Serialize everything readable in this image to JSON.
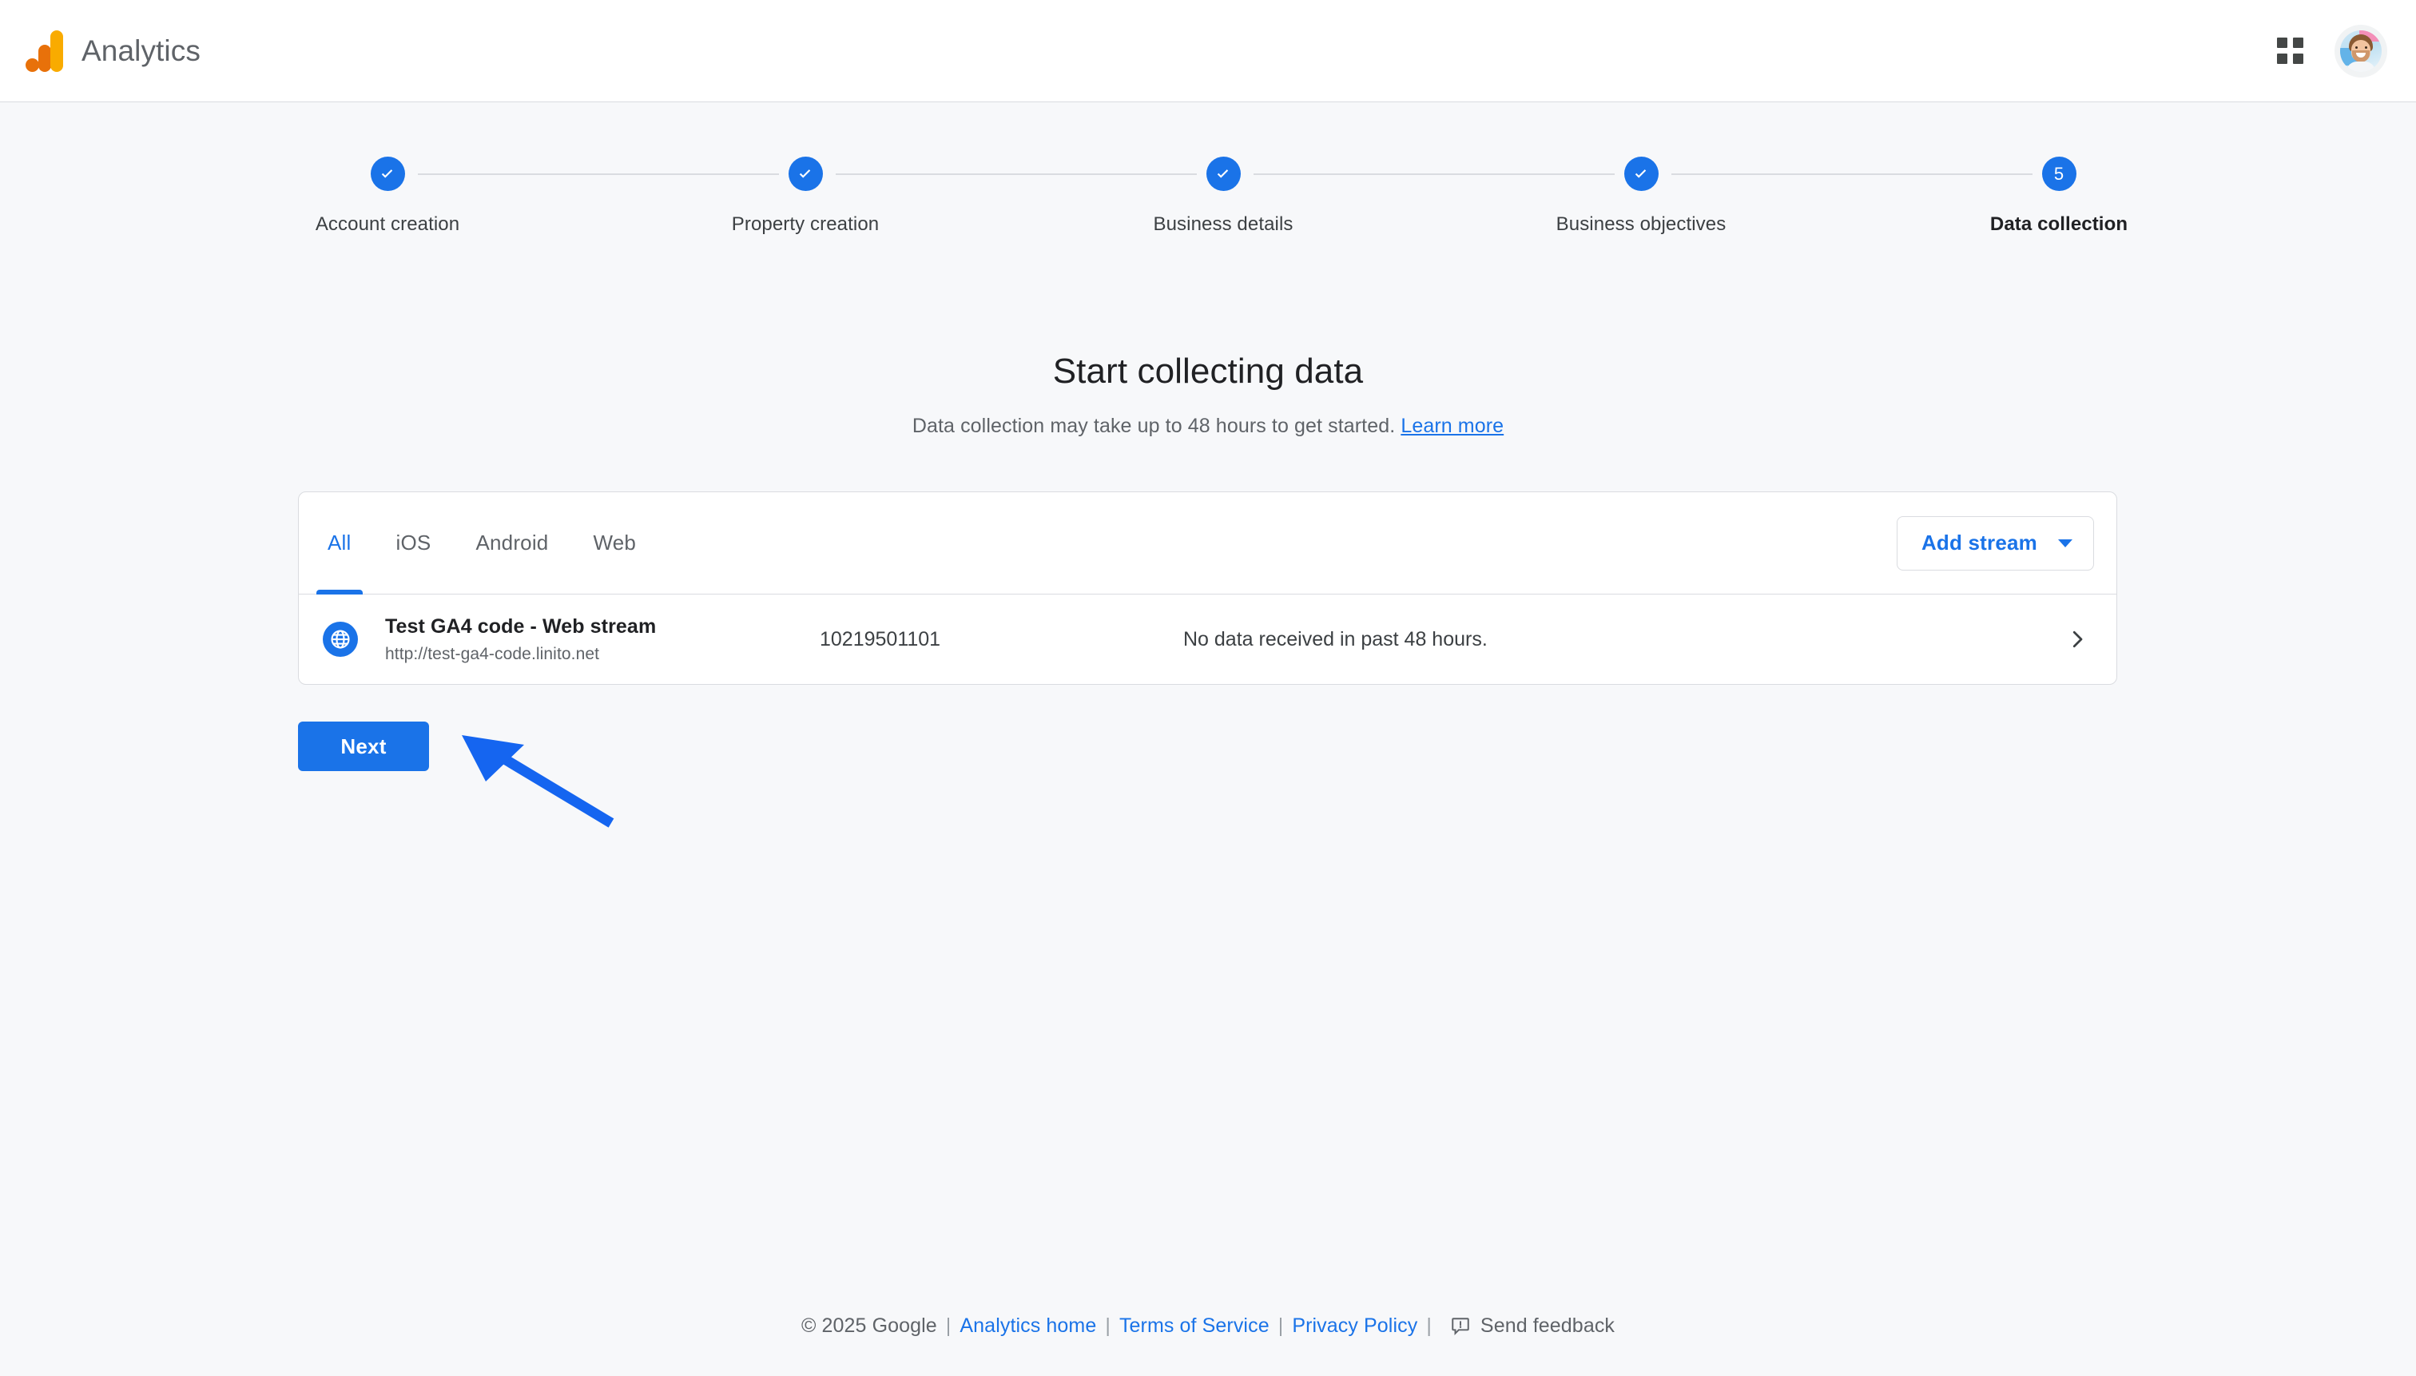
{
  "header": {
    "brand_title": "Analytics",
    "logo_colors": {
      "dot": "#E8710A",
      "bar_mid": "#E8710A",
      "bar_tall": "#F9AB00"
    },
    "apps_icon": "apps-grid-icon",
    "avatar": "user-avatar"
  },
  "stepper": {
    "steps": [
      {
        "label": "Account creation",
        "state": "complete",
        "marker": "check"
      },
      {
        "label": "Property creation",
        "state": "complete",
        "marker": "check"
      },
      {
        "label": "Business details",
        "state": "complete",
        "marker": "check"
      },
      {
        "label": "Business objectives",
        "state": "complete",
        "marker": "check"
      },
      {
        "label": "Data collection",
        "state": "current",
        "marker": "5"
      }
    ],
    "accent_color": "#1a73e8",
    "line_color": "#dadce0"
  },
  "main": {
    "title": "Start collecting data",
    "subtitle_text": "Data collection may take up to 48 hours to get started.",
    "subtitle_link": "Learn more",
    "card": {
      "tabs": [
        {
          "label": "All",
          "active": true
        },
        {
          "label": "iOS",
          "active": false
        },
        {
          "label": "Android",
          "active": false
        },
        {
          "label": "Web",
          "active": false
        }
      ],
      "add_stream_label": "Add stream",
      "streams": [
        {
          "icon": "globe-icon",
          "name": "Test GA4 code - Web stream",
          "url": "http://test-ga4-code.linito.net",
          "measurement_id": "10219501101",
          "status": "No data received in past 48 hours."
        }
      ]
    },
    "next_label": "Next"
  },
  "annotation": {
    "type": "arrow",
    "color": "#1565f0",
    "points_to": "next-button"
  },
  "footer": {
    "copyright": "© 2025 Google",
    "links": [
      {
        "label": "Analytics home"
      },
      {
        "label": "Terms of Service"
      },
      {
        "label": "Privacy Policy"
      }
    ],
    "separator": "|",
    "feedback_label": "Send feedback",
    "feedback_icon": "feedback-bubble-icon"
  }
}
